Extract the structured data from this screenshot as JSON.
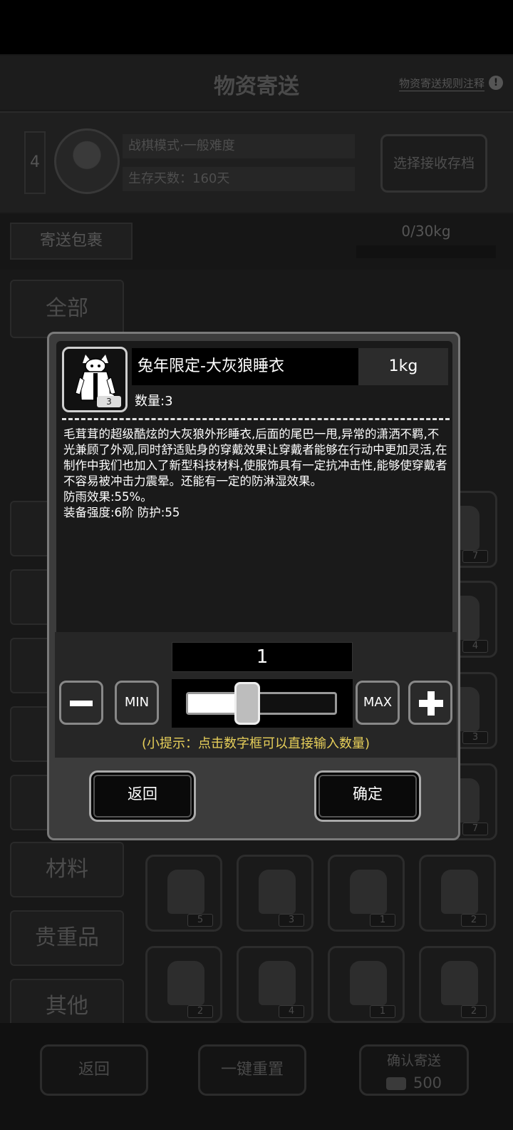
{
  "header": {
    "title": "物资寄送",
    "rules_link": "物资寄送规则注释",
    "info_icon": "!"
  },
  "profile": {
    "slot_number": "4",
    "mode": "战棋模式·一般难度",
    "survival_days": "生存天数：160天",
    "select_save_button": "选择接收存档"
  },
  "package": {
    "send_tab": "寄送包裹",
    "weight": "0/30kg"
  },
  "categories": [
    "全部",
    "材料",
    "贵重品",
    "其他"
  ],
  "inventory_counts": [
    "7",
    "4",
    "3",
    "7",
    "5",
    "3",
    "1",
    "2",
    "2",
    "4",
    "1",
    "2"
  ],
  "bottom_bar": {
    "back_button": "返回",
    "reset_button": "一键重置",
    "confirm_send_label": "确认寄送",
    "confirm_send_cost": "500"
  },
  "dialog": {
    "item_name": "兔年限定-大灰狼睡衣",
    "item_weight": "1kg",
    "item_stack_badge": "3",
    "quantity_label": "数量:3",
    "description": [
      "毛茸茸的超级酷炫的大灰狼外形睡衣,后面的尾巴一甩,异常的潇洒不羁,不光兼顾了外观,同时舒适贴身的穿戴效果让穿戴者能够在行动中更加灵活,在制作中我们也加入了新型科技材料,使服饰具有一定抗冲击性,能够使穿戴者不容易被冲击力震晕。还能有一定的防淋湿效果。",
      "防雨效果:55%。",
      "装备强度:6阶  防护:55"
    ],
    "selected_quantity": "1",
    "min_button": "MIN",
    "max_button": "MAX",
    "slider_fraction": 0.33,
    "hint": "(小提示：点击数字框可以直接输入数量)",
    "back_button": "返回",
    "confirm_button": "确定"
  },
  "colors": {
    "hint": "#e8d05a",
    "dialog_border": "#7a7a7a",
    "dialog_bg": "#3c3c3c"
  }
}
